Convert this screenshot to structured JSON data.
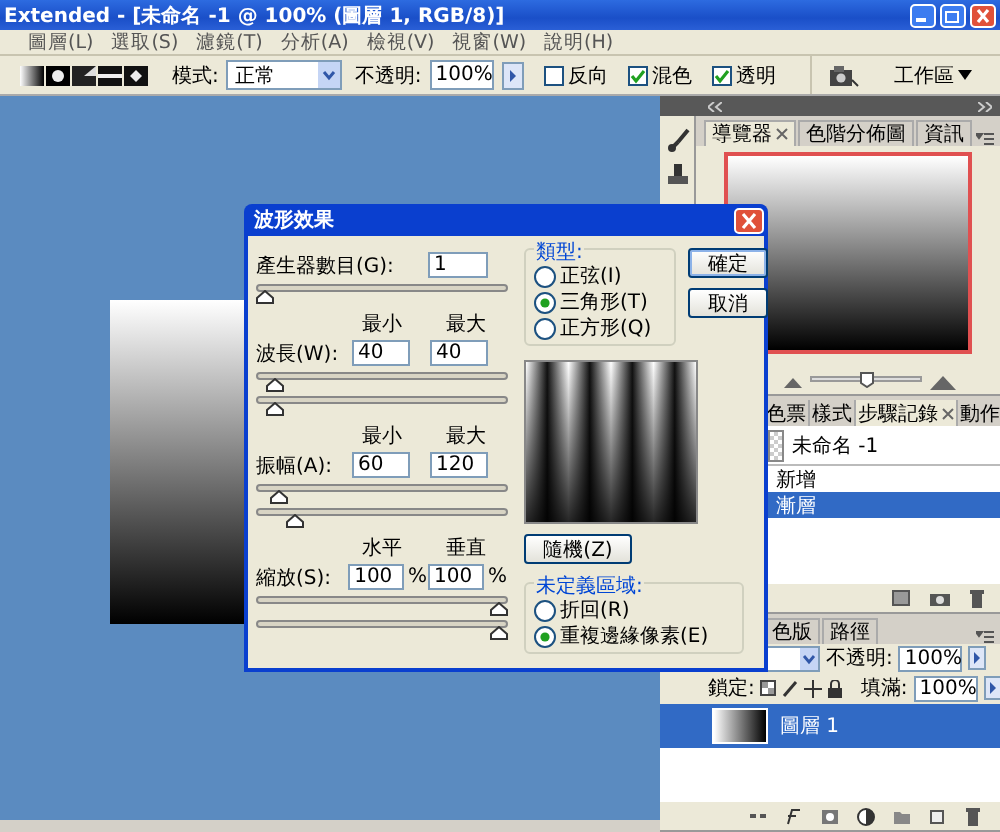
{
  "window": {
    "title": "Extended - [未命名 -1 @ 100% (圖層 1, RGB/8)]"
  },
  "menu": [
    "圖層(L)",
    "選取(S)",
    "濾鏡(T)",
    "分析(A)",
    "檢視(V)",
    "視窗(W)",
    "說明(H)"
  ],
  "options_bar": {
    "mode_label": "模式:",
    "mode": "正常",
    "opacity_label": "不透明:",
    "opacity": "100%",
    "checkboxes": [
      {
        "label": "反向",
        "checked": false
      },
      {
        "label": "混色",
        "checked": true
      },
      {
        "label": "透明",
        "checked": true
      }
    ],
    "workspace": "工作區"
  },
  "dialog": {
    "title": "波形效果",
    "params": [
      {
        "kind": "single",
        "label": "產生器數目(G):",
        "values": [
          "1"
        ],
        "sliders": [
          {
            "level": 0
          }
        ]
      },
      {
        "kind": "pair",
        "headers": [
          "最小",
          "最大"
        ],
        "label": "波長(W):",
        "values": [
          "40",
          "40"
        ],
        "sliders": [
          {
            "level": 0.04
          },
          {
            "level": 0.04
          }
        ]
      },
      {
        "kind": "pair",
        "headers": [
          "最小",
          "最大"
        ],
        "label": "振幅(A):",
        "values": [
          "60",
          "120"
        ],
        "sliders": [
          {
            "level": 0.06
          },
          {
            "level": 0.13
          }
        ]
      },
      {
        "kind": "pair",
        "headers": [
          "水平",
          "垂直"
        ],
        "label": "縮放(S):",
        "values": [
          "100",
          "100"
        ],
        "units": [
          "%",
          "%"
        ],
        "sliders": [
          {
            "level": 1
          },
          {
            "level": 1
          }
        ]
      }
    ],
    "type_group": {
      "title": "類型:",
      "options": [
        {
          "label": "正弦(I)",
          "selected": false
        },
        {
          "label": "三角形(T)",
          "selected": true
        },
        {
          "label": "正方形(Q)",
          "selected": false
        }
      ]
    },
    "buttons": [
      "確定",
      "取消"
    ],
    "randomize": "隨機(Z)",
    "undefined_group": {
      "title": "未定義區域:",
      "options": [
        {
          "label": "折回(R)",
          "selected": false
        },
        {
          "label": "重複邊緣像素(E)",
          "selected": true
        }
      ]
    }
  },
  "navigator_panel": {
    "tabs": [
      {
        "label": "導覽器",
        "selected": true
      },
      {
        "label": "色階分佈圖",
        "selected": false
      },
      {
        "label": "資訊",
        "selected": false
      }
    ],
    "zoom_slider": {
      "level": 0.5
    }
  },
  "history_panel": {
    "tabs": [
      {
        "label": "色票",
        "selected": false
      },
      {
        "label": "樣式",
        "selected": false
      },
      {
        "label": "步驟記錄",
        "selected": true
      },
      {
        "label": "動作",
        "selected": false
      }
    ],
    "snapshot": "未命名 -1",
    "steps": [
      {
        "label": "新增",
        "selected": false
      },
      {
        "label": "漸層",
        "selected": true
      }
    ]
  },
  "layers_panel": {
    "tabs": [
      {
        "label": "色版",
        "selected": false
      },
      {
        "label": "路徑",
        "selected": false
      }
    ],
    "opacity_label": "不透明:",
    "opacity": "100%",
    "lock_label": "鎖定:",
    "fill_label": "填滿:",
    "fill": "100%",
    "layers": [
      {
        "name": "圖層 1",
        "selected": true
      }
    ]
  }
}
